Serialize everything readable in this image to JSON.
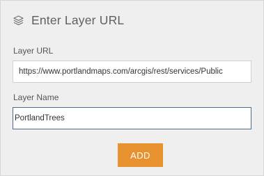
{
  "header": {
    "icon": "layers-icon",
    "title": "Enter Layer URL"
  },
  "fields": {
    "url": {
      "label": "Layer URL",
      "value": "https://www.portlandmaps.com/arcgis/rest/services/Public"
    },
    "name": {
      "label": "Layer Name",
      "value": "PortlandTrees"
    }
  },
  "actions": {
    "add_label": "ADD"
  },
  "colors": {
    "panel_bg": "#efefef",
    "accent_button": "#e8922f",
    "focus_border": "#4a6c8f"
  }
}
